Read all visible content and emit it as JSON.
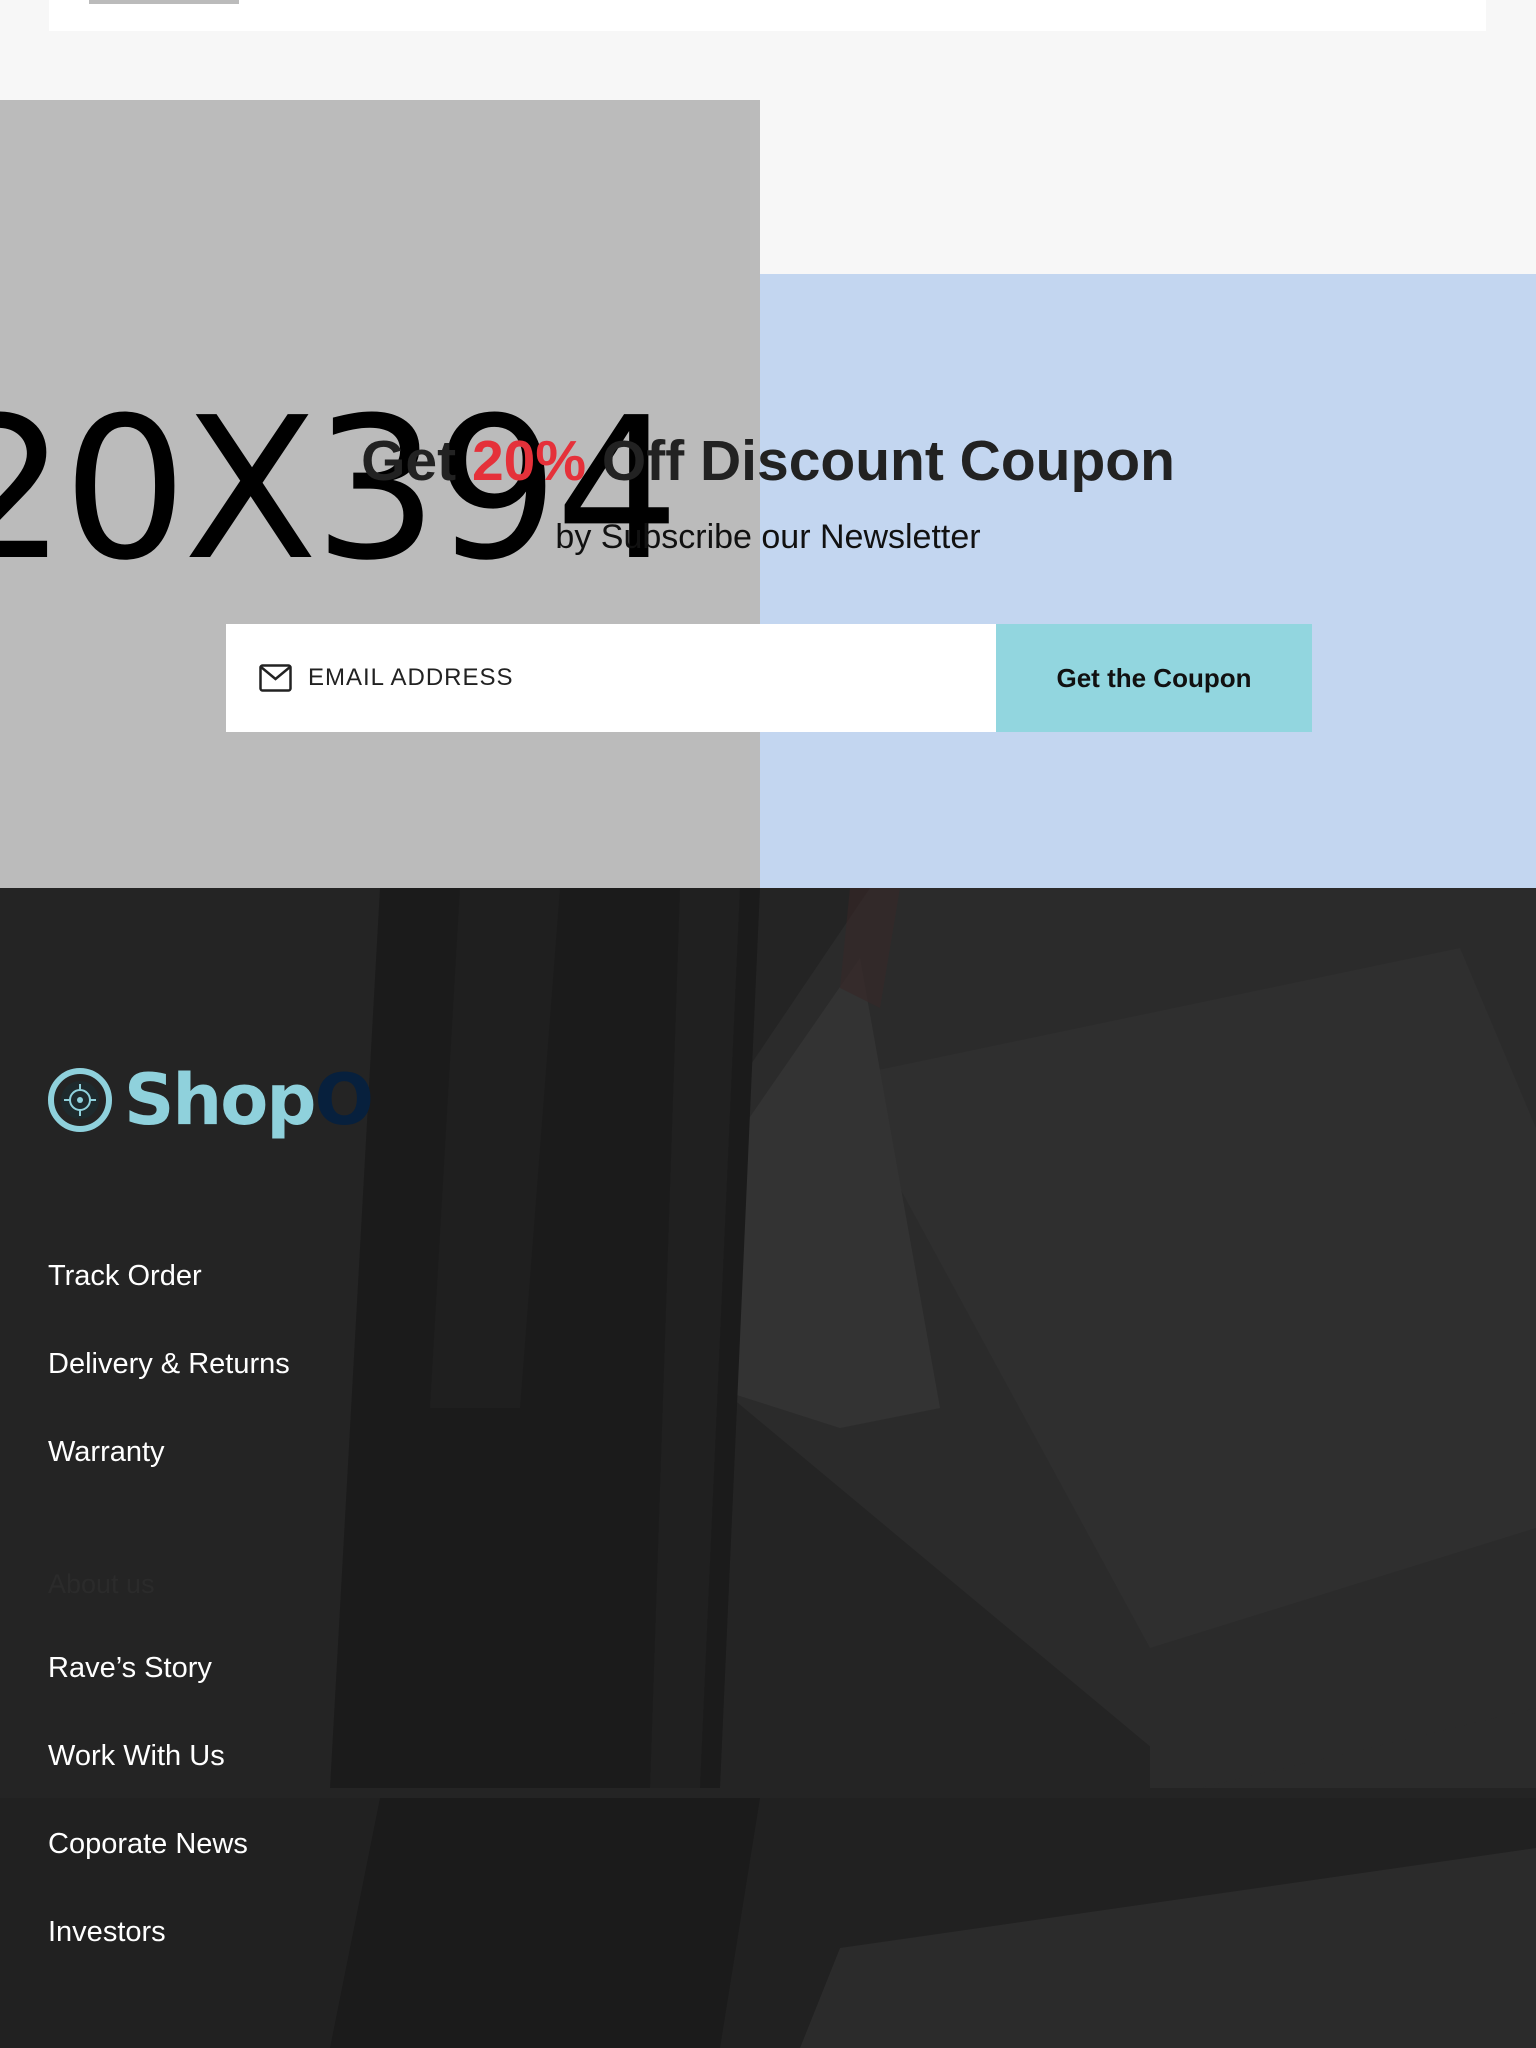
{
  "promo": {
    "placeholder_text": "20X394",
    "headline_prefix": "Get",
    "headline_accent": "20%",
    "headline_suffix": "Off Discount Coupon",
    "subheadline": "by Subscribe our Newsletter",
    "email_placeholder": "EMAIL ADDRESS",
    "button_label": "Get the Coupon",
    "accent_color": "#e5313a",
    "button_color": "#92d6df",
    "panel_color": "#c3d6f0"
  },
  "footer": {
    "logo_text": "Shop",
    "logo_accent": "O",
    "links_primary": [
      "Track Order",
      "Delivery & Returns",
      "Warranty"
    ],
    "section_title": "About us",
    "links_secondary": [
      "Rave’s Story",
      "Work With Us",
      "Coporate News",
      "Investors"
    ],
    "brand_color": "#8fd1dc",
    "brand_dark": "#07203d"
  }
}
